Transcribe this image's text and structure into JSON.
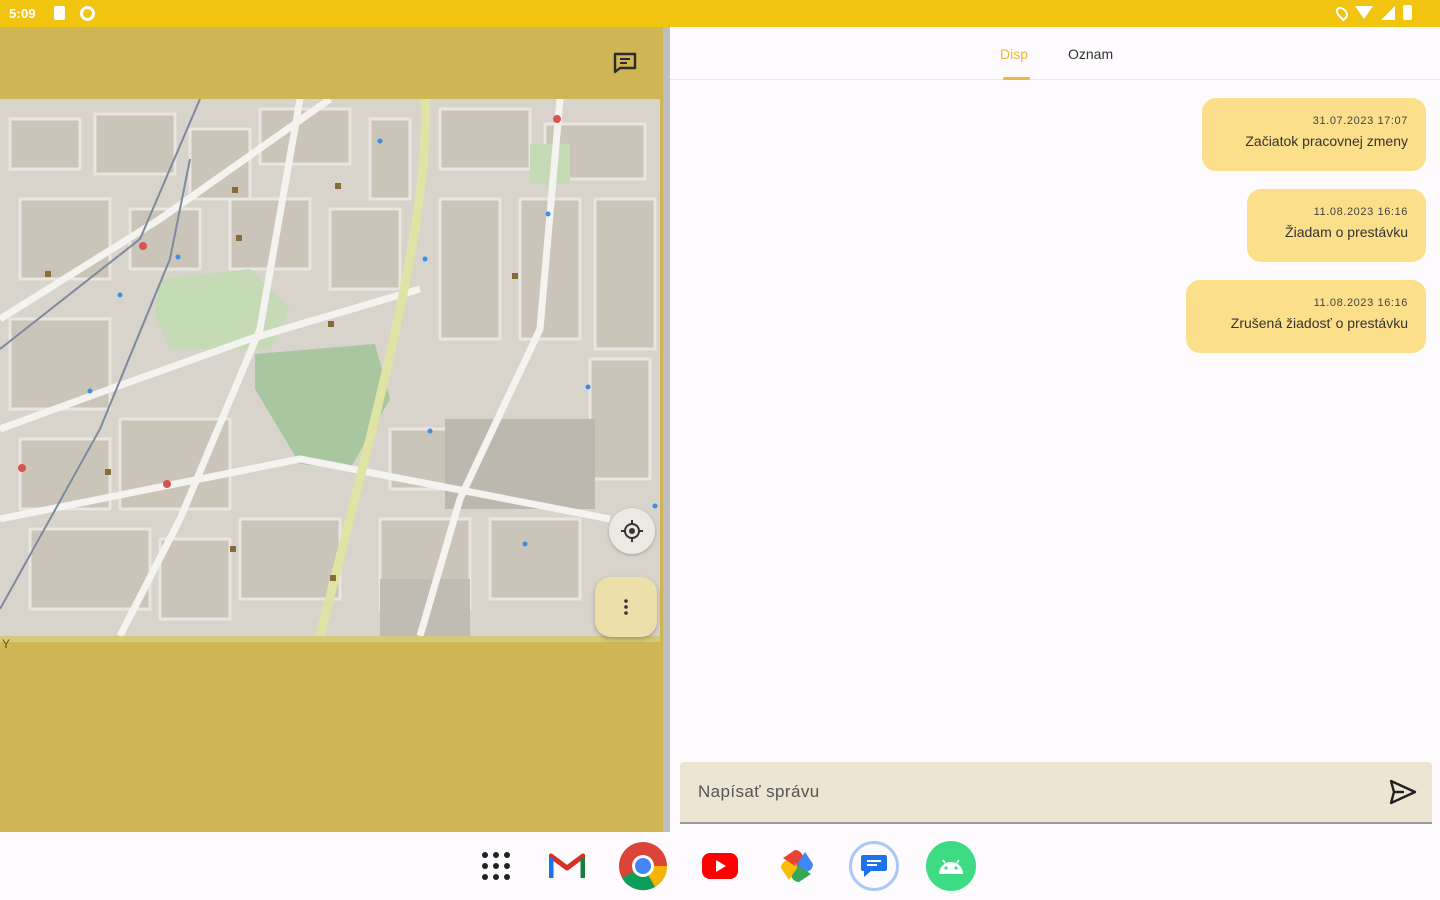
{
  "status_bar": {
    "time": "5:09",
    "icons": [
      "sim-card-icon",
      "vpn-icon",
      "location-icon",
      "wifi-icon",
      "signal-icon",
      "battery-icon"
    ]
  },
  "left_panel": {
    "toolbar_icon": "chat-icon",
    "bottom_letter": "Y",
    "map_controls": [
      "my-location-icon",
      "more-vert-icon"
    ]
  },
  "right_panel": {
    "tabs": [
      {
        "label": "Disp",
        "active": true
      },
      {
        "label": "Oznam",
        "active": false
      }
    ],
    "messages": [
      {
        "timestamp": "31.07.2023 17:07",
        "text": "Začiatok pracovnej zmeny"
      },
      {
        "timestamp": "11.08.2023 16:16",
        "text": "Žiadam o prestávku"
      },
      {
        "timestamp": "11.08.2023 16:16",
        "text": "Zrušená žiadosť o prestávku"
      }
    ],
    "composer": {
      "placeholder": "Napísať správu",
      "send_icon": "send-icon"
    }
  },
  "dock": {
    "apps": [
      "app-drawer-icon",
      "gmail-icon",
      "chrome-icon",
      "youtube-icon",
      "photos-icon",
      "messages-icon",
      "android-icon"
    ]
  },
  "colors": {
    "status_bar": "#f1c40f",
    "left_panel": "#cfb553",
    "bubble": "#fcdf8a",
    "active_tab": "#efb63f",
    "composer": "#ede4d2"
  }
}
